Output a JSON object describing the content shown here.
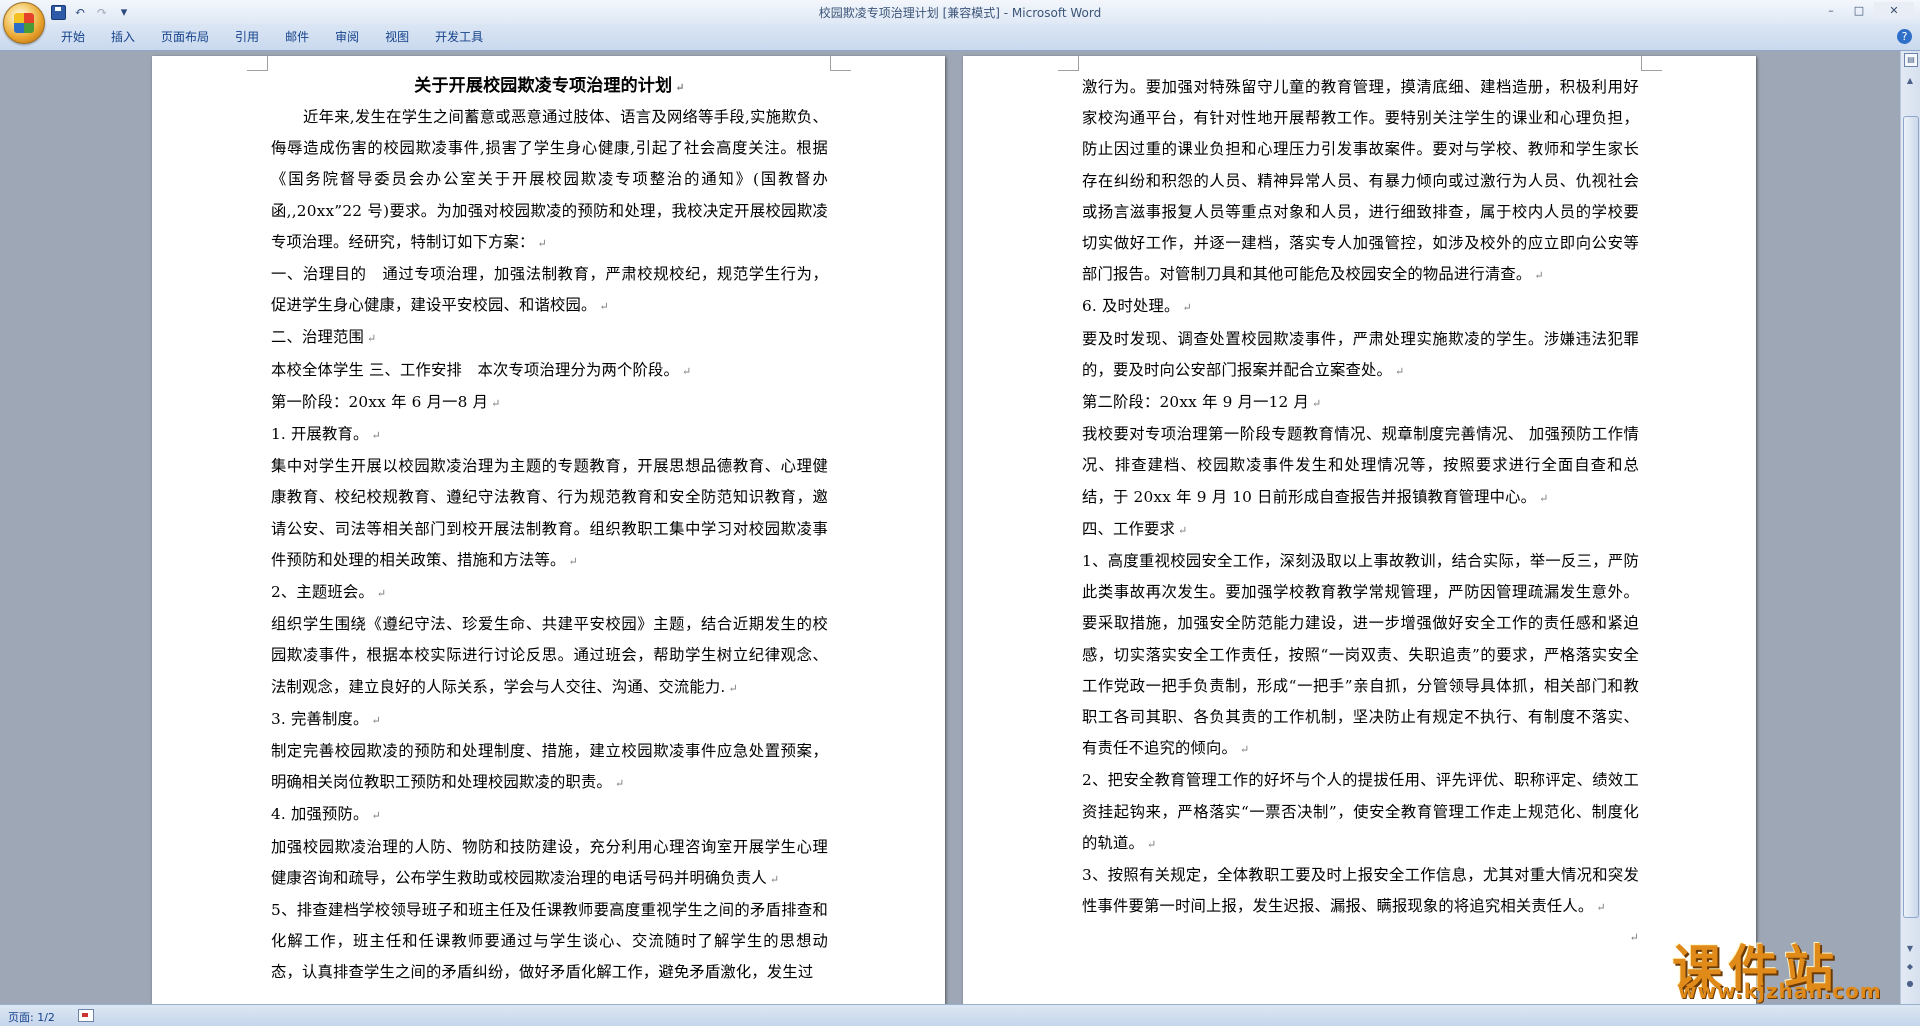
{
  "window": {
    "title": "校园欺凌专项治理计划 [兼容模式] - Microsoft Word",
    "controls": {
      "minimize": "–",
      "maximize": "□",
      "close": "✕"
    }
  },
  "quick_access": {
    "icons": [
      "save-icon",
      "undo-icon",
      "redo-icon",
      "customize-icon"
    ],
    "undo": "↶",
    "redo": "↷",
    "customize": "▾"
  },
  "ribbon": {
    "tabs": [
      "开始",
      "插入",
      "页面布局",
      "引用",
      "邮件",
      "审阅",
      "视图",
      "开发工具"
    ],
    "help": "?"
  },
  "document": {
    "title": "关于开展校园欺凌专项治理的计划",
    "paragraphs_page1": [
      "近年来,发生在学生之间蓄意或恶意通过肢体、语言及网络等手段,实施欺负、侮辱造成伤害的校园欺凌事件,损害了学生身心健康,引起了社会高度关注。根据《国务院督导委员会办公室关于开展校园欺凌专项整治的通知》(国教督办函,,20xx”22 号)要求。为加强对校园欺凌的预防和处理，我校决定开展校园欺凌专项治理。经研究，特制订如下方案：",
      "一、治理目的　通过专项治理，加强法制教育，严肃校规校纪，规范学生行为，促进学生身心健康，建设平安校园、和谐校园。",
      "二、治理范围",
      "本校全体学生 三、工作安排　本次专项治理分为两个阶段。",
      "第一阶段：20xx 年 6 月一8 月",
      "1. 开展教育。",
      "集中对学生开展以校园欺凌治理为主题的专题教育，开展思想品德教育、心理健康教育、校纪校规教育、遵纪守法教育、行为规范教育和安全防范知识教育，邀请公安、司法等相关部门到校开展法制教育。组织教职工集中学习对校园欺凌事件预防和处理的相关政策、措施和方法等。",
      "2、主题班会。",
      "组织学生围绕《遵纪守法、珍爱生命、共建平安校园》主题，结合近期发生的校园欺凌事件，根据本校实际进行讨论反思。通过班会，帮助学生树立纪律观念、法制观念，建立良好的人际关系，学会与人交往、沟通、交流能力.",
      "3. 完善制度。",
      "制定完善校园欺凌的预防和处理制度、措施，建立校园欺凌事件应急处置预案，明确相关岗位教职工预防和处理校园欺凌的职责。",
      "4. 加强预防。",
      "加强校园欺凌治理的人防、物防和技防建设，充分利用心理咨询室开展学生心理健康咨询和疏导，公布学生救助或校园欺凌治理的电话号码并明确负责人",
      "5、排查建档学校领导班子和班主任及任课教师要高度重视学生之间的矛盾排查和化解工作，班主任和任课教师要通过与学生谈心、交流随时了解学生的思想动态，认真排查学生之间的矛盾纠纷，做好矛盾化解工作，避免矛盾激化，发生过"
    ],
    "paragraphs_page2": [
      "激行为。要加强对特殊留守儿童的教育管理，摸清底细、建档造册，积极利用好家校沟通平台，有针对性地开展帮教工作。要特别关注学生的课业和心理负担，防止因过重的课业负担和心理压力引发事故案件。要对与学校、教师和学生家长存在纠纷和积怨的人员、精神异常人员、有暴力倾向或过激行为人员、仇视社会或扬言滋事报复人员等重点对象和人员，进行细致排查，属于校内人员的学校要切实做好工作，并逐一建档，落实专人加强管控，如涉及校外的应立即向公安等部门报告。对管制刀具和其他可能危及校园安全的物品进行清查。",
      "6. 及时处理。",
      "要及时发现、调查处置校园欺凌事件，严肃处理实施欺凌的学生。涉嫌违法犯罪的，要及时向公安部门报案并配合立案查处。",
      "第二阶段：20xx 年 9 月一12 月",
      "我校要对专项治理第一阶段专题教育情况、规章制度完善情况、 加强预防工作情况、排查建档、校园欺凌事件发生和处理情况等，按照要求进行全面自查和总结，于 20xx 年 9 月 10 日前形成自查报告并报镇教育管理中心。",
      "四、工作要求",
      "1、高度重视校园安全工作，深刻汲取以上事故教训，结合实际，举一反三，严防此类事故再次发生。要加强学校教育教学常规管理，严防因管理疏漏发生意外。要采取措施，加强安全防范能力建设，进一步增强做好安全工作的责任感和紧迫感，切实落实安全工作责任，按照“一岗双责、失职追责”的要求，严格落实安全工作党政一把手负责制，形成“一把手”亲自抓，分管领导具体抓，相关部门和教职工各司其职、各负其责的工作机制，坚决防止有规定不执行、有制度不落实、有责任不追究的倾向。",
      "2、把安全教育管理工作的好坏与个人的提拔任用、评先评优、职称评定、绩效工资挂起钩来，严格落实“一票否决制”，使安全教育管理工作走上规范化、制度化的轨道。",
      "3、按照有关规定，全体教职工要及时上报安全工作信息，尤其对重大情况和突发性事件要第一时间上报，发生迟报、漏报、瞒报现象的将追究相关责任人。"
    ],
    "paragraph_mark": "↵"
  },
  "statusbar": {
    "page_info": "页面: 1/2"
  },
  "watermark": {
    "main": "课件站",
    "url": "www.kjzhan.com"
  },
  "colors": {
    "ribbon_text": "#15428b",
    "doc_background": "#9ea7b5",
    "watermark": "#e08a1a"
  }
}
